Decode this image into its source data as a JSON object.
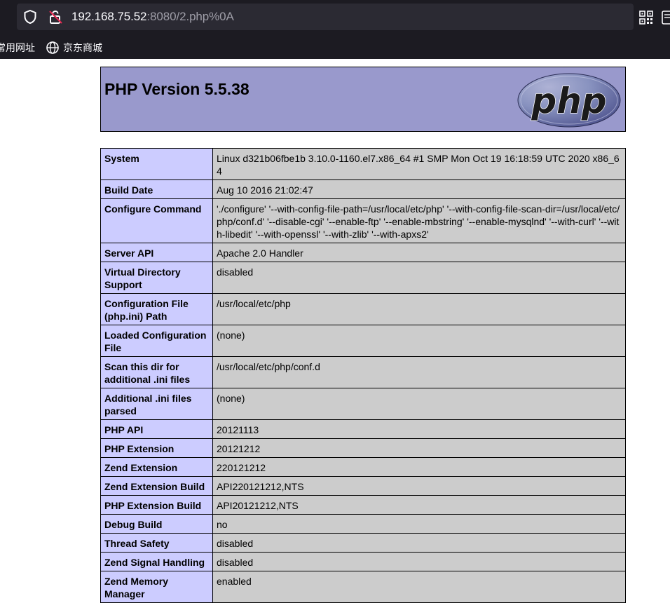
{
  "browser": {
    "url_host": "192.168.75.52",
    "url_rest": ":8080/2.php%0A",
    "bookmarks": [
      {
        "label": "常用网址"
      },
      {
        "label": "京东商城"
      }
    ]
  },
  "page": {
    "title": "PHP Version 5.5.38",
    "logo_text": "php"
  },
  "rows": [
    {
      "key": "System",
      "value": "Linux d321b06fbe1b 3.10.0-1160.el7.x86_64 #1 SMP Mon Oct 19 16:18:59 UTC 2020 x86_64"
    },
    {
      "key": "Build Date",
      "value": "Aug 10 2016 21:02:47"
    },
    {
      "key": "Configure Command",
      "value": "'./configure' '--with-config-file-path=/usr/local/etc/php' '--with-config-file-scan-dir=/usr/local/etc/php/conf.d' '--disable-cgi' '--enable-ftp' '--enable-mbstring' '--enable-mysqlnd' '--with-curl' '--with-libedit' '--with-openssl' '--with-zlib' '--with-apxs2'"
    },
    {
      "key": "Server API",
      "value": "Apache 2.0 Handler"
    },
    {
      "key": "Virtual Directory Support",
      "value": "disabled"
    },
    {
      "key": "Configuration File (php.ini) Path",
      "value": "/usr/local/etc/php"
    },
    {
      "key": "Loaded Configuration File",
      "value": "(none)"
    },
    {
      "key": "Scan this dir for additional .ini files",
      "value": "/usr/local/etc/php/conf.d"
    },
    {
      "key": "Additional .ini files parsed",
      "value": "(none)"
    },
    {
      "key": "PHP API",
      "value": "20121113"
    },
    {
      "key": "PHP Extension",
      "value": "20121212"
    },
    {
      "key": "Zend Extension",
      "value": "220121212"
    },
    {
      "key": "Zend Extension Build",
      "value": "API220121212,NTS"
    },
    {
      "key": "PHP Extension Build",
      "value": "API20121212,NTS"
    },
    {
      "key": "Debug Build",
      "value": "no"
    },
    {
      "key": "Thread Safety",
      "value": "disabled"
    },
    {
      "key": "Zend Signal Handling",
      "value": "disabled"
    },
    {
      "key": "Zend Memory Manager",
      "value": "enabled"
    }
  ],
  "colors": {
    "header_bg": "#9999cc",
    "key_bg": "#ccccff",
    "value_bg": "#cccccc",
    "chrome_bg": "#1c1b22",
    "urlbar_bg": "#2b2a33"
  }
}
